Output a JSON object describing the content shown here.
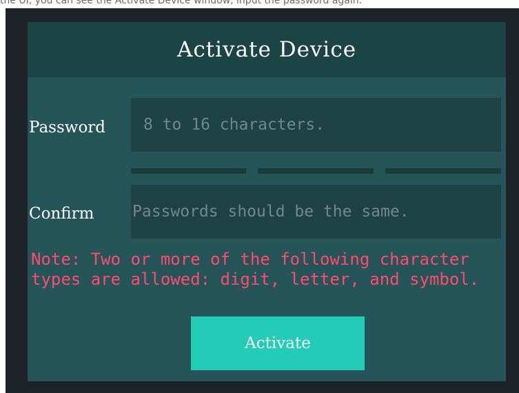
{
  "background_caption": "the UI, you can see the Activate Device window, input the password again.",
  "dialog": {
    "title": "Activate Device",
    "password_label": "Password",
    "password_placeholder": "8 to 16 characters.",
    "confirm_label": "Confirm",
    "confirm_placeholder": "Passwords should be the same.",
    "strength_levels_filled": 0,
    "strength_levels_total": 3,
    "note": "Note: Two or more of the following character types are allowed: digit, letter, and symbol.",
    "activate_label": "Activate"
  },
  "colors": {
    "frame": "#1c2228",
    "dialog_body": "#255558",
    "dialog_header": "#1d4445",
    "input_bg": "#1f4244",
    "note_text": "#ff4b6e",
    "accent_button": "#22ccb6"
  }
}
